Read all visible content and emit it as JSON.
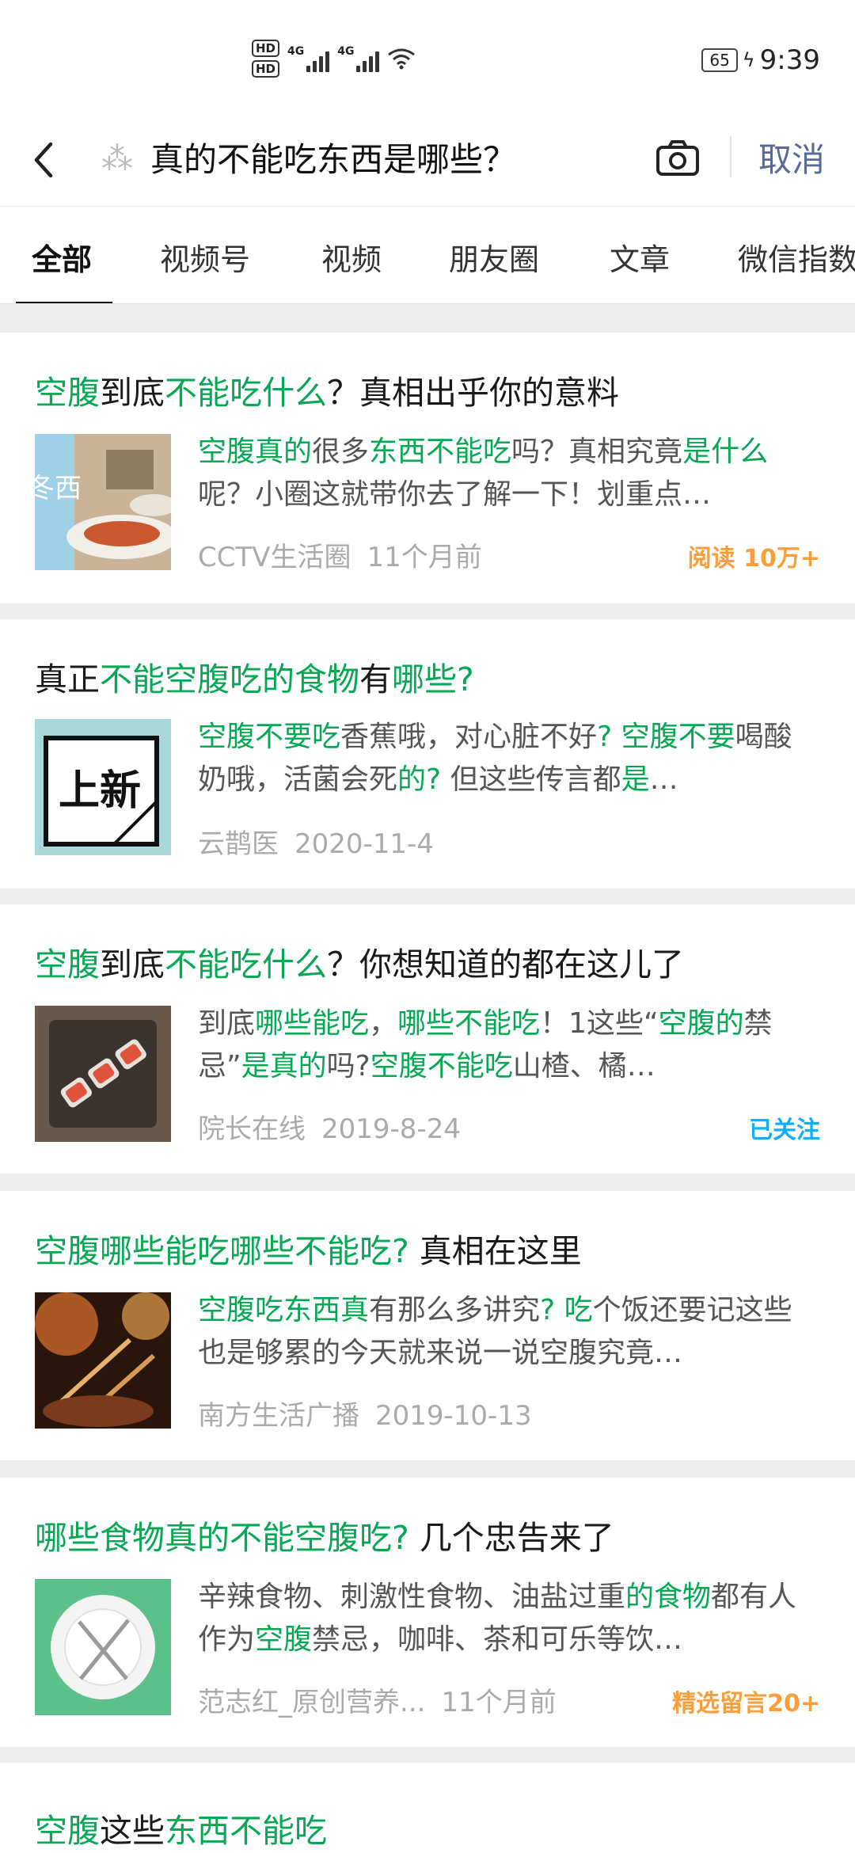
{
  "status_bar": {
    "hd1": "HD",
    "hd2": "HD",
    "net1": "4G",
    "net2": "4G",
    "battery": "65",
    "time": "9:39"
  },
  "header": {
    "query": "真的不能吃东西是哪些？",
    "cancel_label": "取消"
  },
  "tabs": [
    "全部",
    "视频号",
    "视频",
    "朋友圈",
    "文章",
    "微信指数"
  ],
  "results": [
    {
      "title": [
        [
          "空腹",
          true
        ],
        [
          "到底",
          false
        ],
        [
          "不能吃什么",
          true
        ],
        [
          "？真相出乎你的意料",
          false
        ]
      ],
      "snippet": [
        [
          "空腹真的",
          true
        ],
        [
          "很多",
          false
        ],
        [
          "东西不能吃",
          true
        ],
        [
          "吗？真相究竟",
          false
        ],
        [
          "是什么",
          true
        ],
        [
          "呢？小圈这就带你去了解一下！划重点…",
          false
        ]
      ],
      "thumb_text": "冬西",
      "source": "CCTV生活圈",
      "time": "11个月前",
      "tag": "阅读 10万+",
      "tag_color": "orange"
    },
    {
      "title": [
        [
          "真正",
          false
        ],
        [
          "不能空腹吃的食物",
          true
        ],
        [
          "有",
          false
        ],
        [
          "哪些?",
          true
        ]
      ],
      "snippet": [
        [
          "空腹不要吃",
          true
        ],
        [
          "香蕉哦，对心脏不好",
          false
        ],
        [
          "?",
          true
        ],
        [
          " ",
          false
        ],
        [
          "空腹不要",
          true
        ],
        [
          "喝酸奶哦，活菌会死",
          false
        ],
        [
          "的?",
          true
        ],
        [
          " 但这些传言都",
          false
        ],
        [
          "是",
          true
        ],
        [
          "…",
          false
        ]
      ],
      "thumb_text": "上新",
      "source": "云鹊医",
      "time": "2020-11-4",
      "tag": "",
      "tag_color": ""
    },
    {
      "title": [
        [
          "空腹",
          true
        ],
        [
          "到底",
          false
        ],
        [
          "不能吃什么",
          true
        ],
        [
          "？你想知道的都在这儿了",
          false
        ]
      ],
      "snippet": [
        [
          "到底",
          false
        ],
        [
          "哪些能吃",
          true
        ],
        [
          "，",
          false
        ],
        [
          "哪些不能吃",
          true
        ],
        [
          "！1这些“",
          false
        ],
        [
          "空腹的",
          true
        ],
        [
          "禁忌”",
          false
        ],
        [
          "是真的",
          true
        ],
        [
          "吗?",
          false
        ],
        [
          "空腹不能吃",
          true
        ],
        [
          "山楂、橘…",
          false
        ]
      ],
      "thumb_text": "",
      "source": "院长在线",
      "time": "2019-8-24",
      "tag": "已关注",
      "tag_color": "blue"
    },
    {
      "title": [
        [
          "空腹哪些能吃哪些不能吃?",
          true
        ],
        [
          " 真相在这里",
          false
        ]
      ],
      "snippet": [
        [
          "空腹吃东西真",
          true
        ],
        [
          "有那么多讲究",
          false
        ],
        [
          "?",
          true
        ],
        [
          " ",
          false
        ],
        [
          "吃",
          true
        ],
        [
          "个饭还要记这些也是够累的今天就来说一说空腹究竟…",
          false
        ]
      ],
      "thumb_text": "",
      "source": "南方生活广播",
      "time": "2019-10-13",
      "tag": "",
      "tag_color": ""
    },
    {
      "title": [
        [
          "哪些食物真的不能空腹吃?",
          true
        ],
        [
          " 几个忠告来了",
          false
        ]
      ],
      "snippet": [
        [
          "辛辣食物、刺激性食物、油盐过重",
          false
        ],
        [
          "的食物",
          true
        ],
        [
          "都有人作为",
          false
        ],
        [
          "空腹",
          true
        ],
        [
          "禁忌，咖啡、茶和可乐等饮…",
          false
        ]
      ],
      "thumb_text": "",
      "source": "范志红_原创营养...",
      "time": "11个月前",
      "tag": "精选留言20+",
      "tag_color": "orange"
    },
    {
      "title": [
        [
          "空腹",
          true
        ],
        [
          "这些",
          false
        ],
        [
          "东西不能吃",
          true
        ]
      ],
      "snippet": [],
      "thumb_text": "",
      "source": "",
      "time": "",
      "tag": "",
      "tag_color": ""
    }
  ]
}
